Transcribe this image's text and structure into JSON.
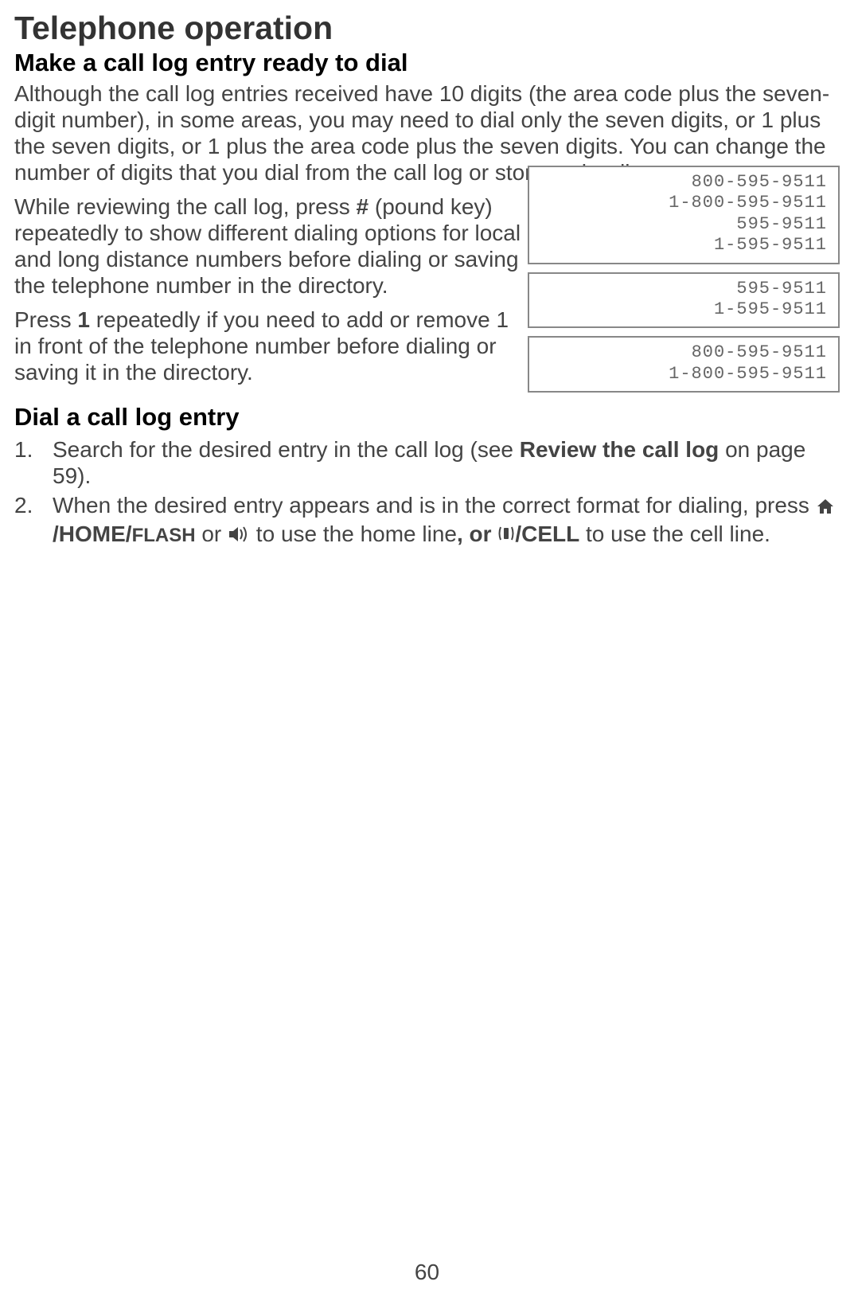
{
  "title": "Telephone operation",
  "section1": {
    "heading": "Make a call log entry ready to dial",
    "p1": "Although the call log entries received have 10 digits (the area code plus the seven-digit number), in some areas, you may need to dial only the seven digits, or 1 plus the seven digits, or 1 plus the area code plus the seven digits. You can change the number of digits that you dial from the call log or store to the directory.",
    "p2_a": "While reviewing the call log, press ",
    "p2_key": "#",
    "p2_b": " (pound key) repeatedly to show different dialing options for local and long distance numbers before dialing or saving the telephone number in the directory.",
    "p3_a": "Press ",
    "p3_key": "1",
    "p3_b": " repeatedly if you need to add or remove 1 in front of the telephone number before dialing or saving it in the directory."
  },
  "section2": {
    "heading": "Dial a call log entry",
    "items": [
      {
        "pre": "Search for the desired entry in the call log (see ",
        "bold": "Review the call log",
        "post": " on page 59)."
      },
      {
        "pre": "When the desired entry appears and is in the correct format for dialing, press ",
        "home_label": "/HOME/",
        "flash_label": "FLASH",
        "or": " or ",
        "mid": " to use the home line",
        "comma_or": ", or ",
        "cell_label": "/CELL",
        "post": " to use the cell line."
      }
    ]
  },
  "displays": {
    "box1": [
      "800-595-9511",
      "1-800-595-9511",
      "595-9511",
      "1-595-9511"
    ],
    "box2": [
      "595-9511",
      "1-595-9511"
    ],
    "box3": [
      "800-595-9511",
      "1-800-595-9511"
    ]
  },
  "page_number": "60"
}
